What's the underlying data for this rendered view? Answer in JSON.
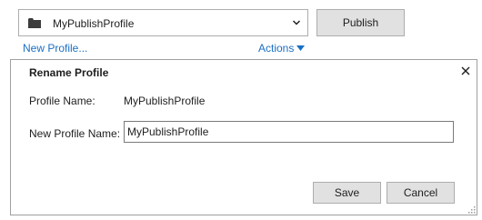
{
  "profile_select": {
    "selected": "MyPublishProfile",
    "icon": "folder-icon"
  },
  "toolbar": {
    "publish_label": "Publish",
    "new_profile_label": "New Profile...",
    "actions_label": "Actions"
  },
  "dialog": {
    "title": "Rename Profile",
    "profile_name_label": "Profile Name:",
    "profile_name_value": "MyPublishProfile",
    "new_name_label": "New Profile Name:",
    "new_name_value": "MyPublishProfile",
    "save_label": "Save",
    "cancel_label": "Cancel"
  },
  "colors": {
    "link": "#1a6fc4",
    "button_bg": "#e1e1e1",
    "border": "#adadad"
  }
}
